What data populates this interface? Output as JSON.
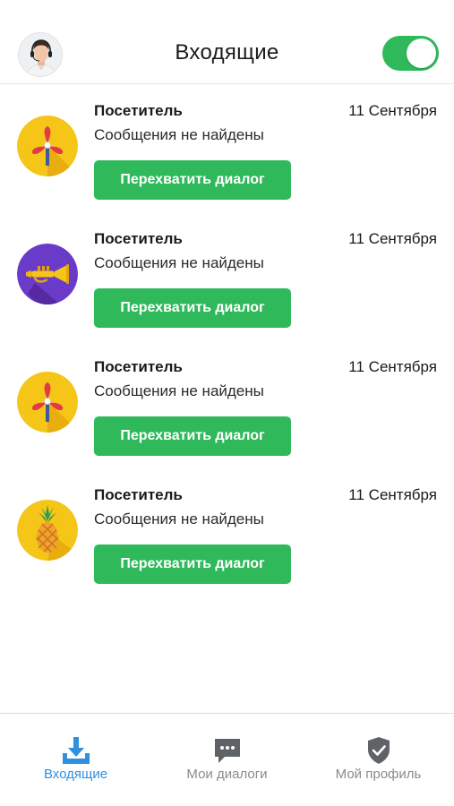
{
  "header": {
    "title": "Входящие",
    "toggle_on": true,
    "accent_color": "#2fb95a"
  },
  "items": [
    {
      "icon": "fan-icon",
      "name": "Посетитель",
      "date": "11 Сентября",
      "message": "Сообщения не найдены",
      "button": "Перехватить диалог"
    },
    {
      "icon": "trumpet-icon",
      "name": "Посетитель",
      "date": "11 Сентября",
      "message": "Сообщения не найдены",
      "button": "Перехватить диалог"
    },
    {
      "icon": "fan-icon",
      "name": "Посетитель",
      "date": "11 Сентября",
      "message": "Сообщения не найдены",
      "button": "Перехватить диалог"
    },
    {
      "icon": "pineapple-icon",
      "name": "Посетитель",
      "date": "11 Сентября",
      "message": "Сообщения не найдены",
      "button": "Перехватить диалог"
    }
  ],
  "tabbar": {
    "tabs": [
      {
        "icon": "inbox-download-icon",
        "label": "Входящие",
        "active": true
      },
      {
        "icon": "chat-bubble-icon",
        "label": "Мои диалоги",
        "active": false
      },
      {
        "icon": "shield-check-icon",
        "label": "Мой профиль",
        "active": false
      }
    ],
    "active_color": "#2f8fe0",
    "inactive_color": "#8b8b8b"
  }
}
